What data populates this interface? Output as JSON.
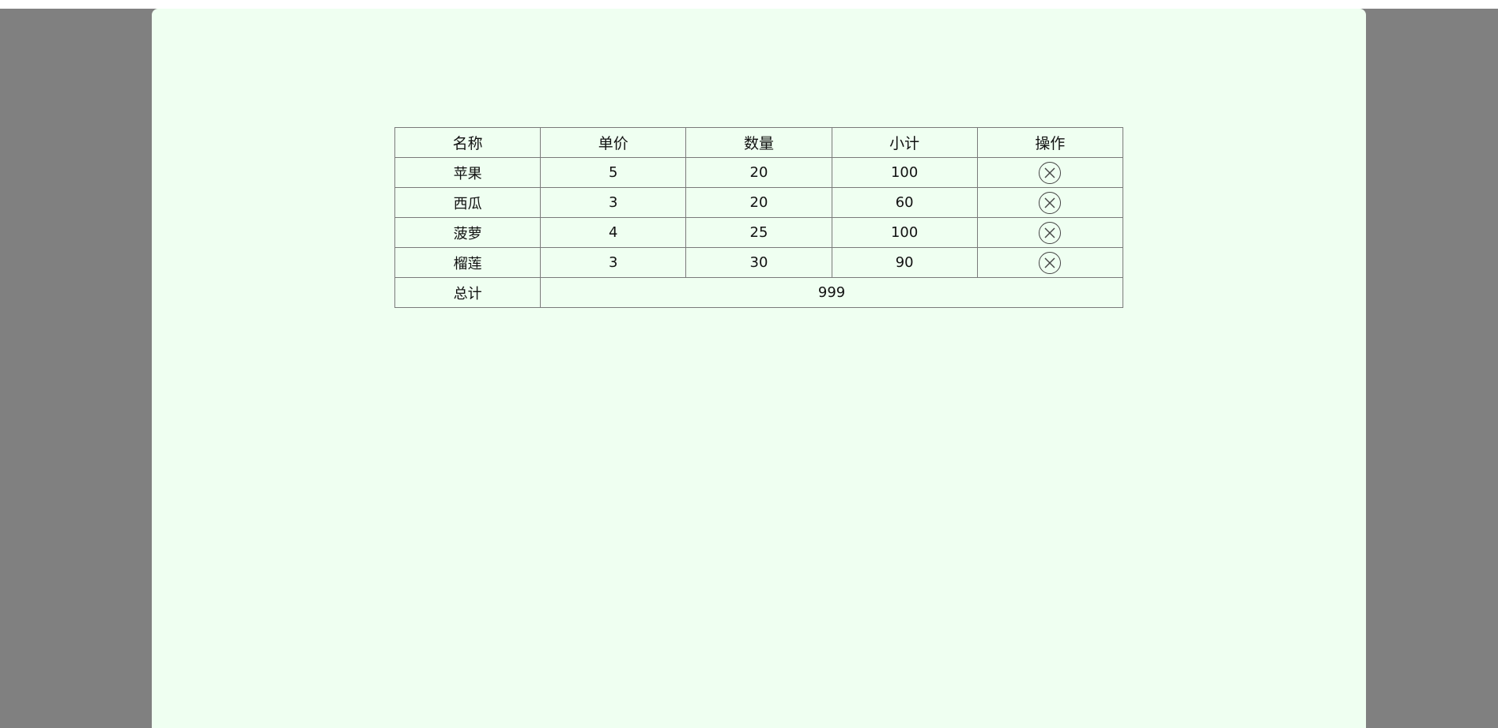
{
  "table": {
    "headers": [
      "名称",
      "单价",
      "数量",
      "小计",
      "操作"
    ],
    "rows": [
      {
        "name": "苹果",
        "price": "5",
        "quantity": "20",
        "subtotal": "100",
        "action_icon": "close-circle-icon"
      },
      {
        "name": "西瓜",
        "price": "3",
        "quantity": "20",
        "subtotal": "60",
        "action_icon": "close-circle-icon"
      },
      {
        "name": "菠萝",
        "price": "4",
        "quantity": "25",
        "subtotal": "100",
        "action_icon": "close-circle-icon"
      },
      {
        "name": "榴莲",
        "price": "3",
        "quantity": "30",
        "subtotal": "90",
        "action_icon": "close-circle-icon"
      }
    ],
    "total_label": "总计",
    "total_value": "999"
  },
  "colors": {
    "backdrop": "#808080",
    "panel": "#effff1",
    "border": "#7a7a7a"
  }
}
